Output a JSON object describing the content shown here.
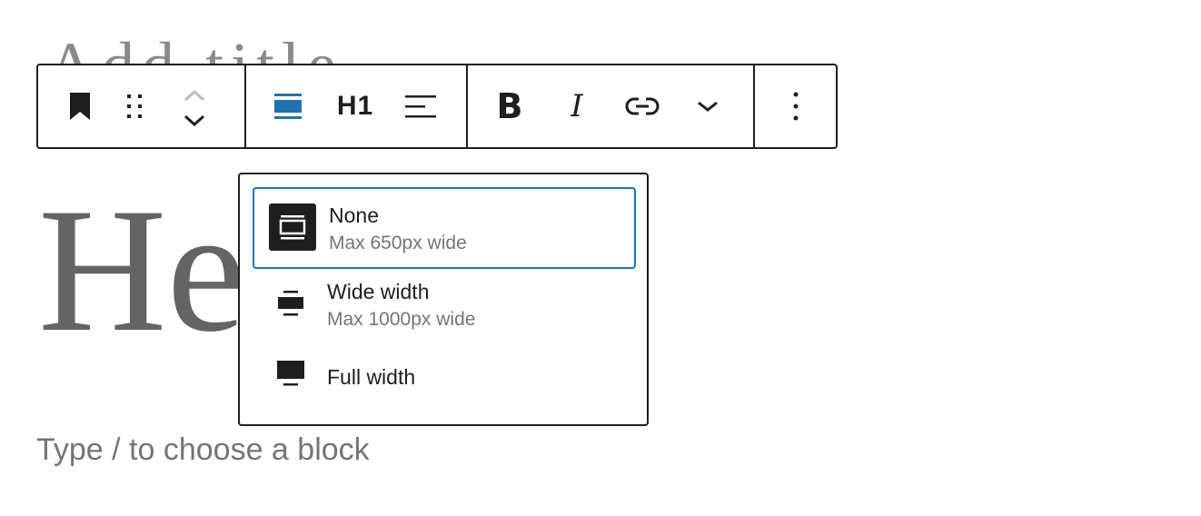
{
  "editor": {
    "title_partial": "Add title",
    "heading_partial": "He",
    "block_placeholder": "Type / to choose a block"
  },
  "toolbar": {
    "heading_level": "H1",
    "bold": "B",
    "italic": "I"
  },
  "align_menu": {
    "options": [
      {
        "title": "None",
        "subtitle": "Max 650px wide",
        "selected": true
      },
      {
        "title": "Wide width",
        "subtitle": "Max 1000px wide",
        "selected": false
      },
      {
        "title": "Full width",
        "subtitle": "",
        "selected": false
      }
    ]
  },
  "colors": {
    "accent": "#2271b1",
    "text": "#1e1e1e",
    "muted": "#757575"
  }
}
